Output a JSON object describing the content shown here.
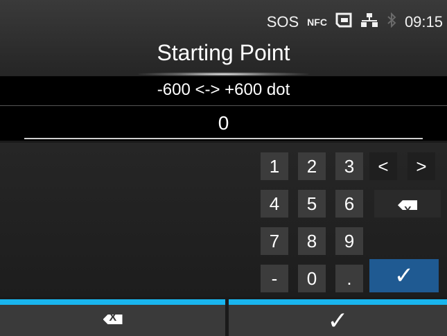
{
  "status": {
    "sos": "SOS",
    "nfc": "NFC",
    "time": "09:15",
    "icons": [
      "nfc-icon",
      "memory-card-icon",
      "network-icon",
      "bluetooth-icon"
    ]
  },
  "title": "Starting Point",
  "range_text": "-600 <-> +600 dot",
  "value": "0",
  "keypad": {
    "keys": [
      "1",
      "2",
      "3",
      "4",
      "5",
      "6",
      "7",
      "8",
      "9",
      "-",
      "0",
      "."
    ],
    "left_arrow": "<",
    "right_arrow": ">",
    "backspace_label": "X",
    "ok_symbol": "✓"
  },
  "bottom": {
    "backspace_label": "X",
    "confirm_symbol": "✓"
  },
  "colors": {
    "accent_blue": "#19b5ee",
    "ok_key": "#1f5a92"
  }
}
